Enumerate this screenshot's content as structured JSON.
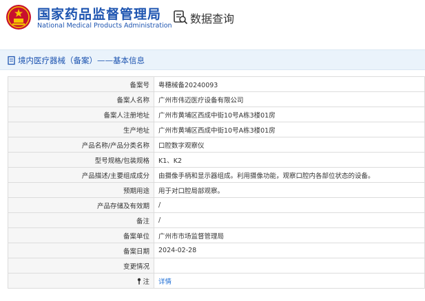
{
  "header": {
    "org_cn": "国家药品监督管理局",
    "org_en": "National Medical Products Administration",
    "module_title": "数据查询",
    "brand_color": "#1d54b0"
  },
  "section_title": "境内医疗器械（备案）——基本信息",
  "rows": [
    {
      "label": "备案号",
      "value": "粤穗械备20240093"
    },
    {
      "label": "备案人名称",
      "value": "广州市伟迈医疗设备有限公司"
    },
    {
      "label": "备案人注册地址",
      "value": "广州市黄埔区西成中街10号A栋3楼01房"
    },
    {
      "label": "生产地址",
      "value": "广州市黄埔区西成中街10号A栋3楼01房"
    },
    {
      "label": "产品名称/产品分类名称",
      "value": "口腔数字观察仪"
    },
    {
      "label": "型号规格/包装规格",
      "value": "K1、K2"
    },
    {
      "label": "产品描述/主要组成成分",
      "value": "由摄像手柄和显示器组成。利用摄像功能，观察口腔内各部位状态的设备。"
    },
    {
      "label": "预期用途",
      "value": "用于对口腔局部观察。"
    },
    {
      "label": "产品存储及有效期",
      "value": "/"
    },
    {
      "label": "备注",
      "value": "/"
    },
    {
      "label": "备案单位",
      "value": "广州市市场监督管理局"
    },
    {
      "label": "备案日期",
      "value": "2024-02-28"
    },
    {
      "label": "变更情况",
      "value": ""
    },
    {
      "label": "注",
      "value": "详情",
      "icon": "note-icon",
      "is_link": true
    }
  ]
}
